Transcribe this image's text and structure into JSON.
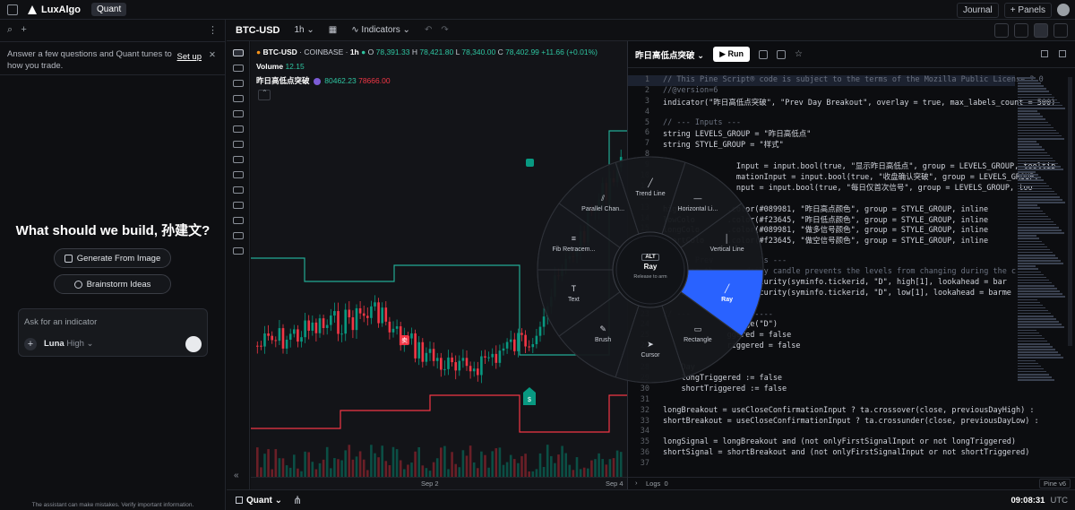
{
  "app": {
    "brand": "LuxAlgo",
    "mode": "Quant",
    "journal": "Journal",
    "panels": "Panels"
  },
  "left": {
    "notice_text": "Answer a few questions and Quant tunes to how you trade.",
    "setup_label": "Set up",
    "hero": "What should we build, 孙建文?",
    "generate_label": "Generate From Image",
    "brainstorm_label": "Brainstorm Ideas",
    "ask_placeholder": "Ask for an indicator",
    "model_name": "Luna",
    "model_level": "High",
    "disclaimer": "The assistant can make mistakes. Verify important information."
  },
  "chart_header": {
    "symbol": "BTC-USD",
    "interval": "1h",
    "indicators": "Indicators"
  },
  "legend": {
    "symbol": "BTC-USD",
    "exchange": "COINBASE",
    "interval": "1h",
    "o_label": "O",
    "o": "78,391.33",
    "h_label": "H",
    "h": "78,421.80",
    "l_label": "L",
    "l": "78,340.00",
    "c_label": "C",
    "c": "78,402.99",
    "change": "+11.66 (+0.01%)",
    "volume_label": "Volume",
    "volume": "12.15",
    "indicator_name": "昨日高低点突破",
    "ind_high": "80462.23",
    "ind_low": "78666.00"
  },
  "xaxis": {
    "labels": [
      "Sep 2",
      "Sep 4"
    ]
  },
  "bottom": {
    "quant": "Quant",
    "time": "09:08:31",
    "tz": "UTC"
  },
  "editor": {
    "script_name": "昨日高低点突破",
    "run_label": "Run",
    "logs_label": "Logs",
    "logs_count": "0",
    "pine_version": "Pine v6",
    "lines": [
      {
        "n": "1",
        "t": "// This Pine Script® code is subject to the terms of the Mozilla Public License 2.0"
      },
      {
        "n": "2",
        "t": "//@version=6"
      },
      {
        "n": "3",
        "t": "indicator(\"昨日高低点突破\", \"Prev Day Breakout\", overlay = true, max_labels_count = 500)"
      },
      {
        "n": "4",
        "t": ""
      },
      {
        "n": "5",
        "t": "// --- Inputs ---"
      },
      {
        "n": "6",
        "t": "string LEVELS_GROUP = \"昨日高低点\""
      },
      {
        "n": "7",
        "t": "string STYLE_GROUP = \"样式\""
      },
      {
        "n": "8",
        "t": ""
      },
      {
        "n": "9",
        "t": "                Input = input.bool(true, \"显示昨日高低点\", group = LEVELS_GROUP, tooltip"
      },
      {
        "n": "10",
        "t": "                mationInput = input.bool(true, \"收盘确认突破\", group = LEVELS_GROUP,"
      },
      {
        "n": "11",
        "t": "                nput = input.bool(true, \"每日仅首次信号\", group = LEVELS_GROUP, too"
      },
      {
        "n": "12",
        "t": ""
      },
      {
        "n": "13",
        "t": "highC         .color(#089981, \"昨日高点颜色\", group = STYLE_GROUP, inline"
      },
      {
        "n": "14",
        "t": "lowColo       .color(#f23645, \"昨日低点颜色\", group = STYLE_GROUP, inline"
      },
      {
        "n": "15",
        "t": "longColo      .color(#089981, \"做多信号颜色\", group = STYLE_GROUP, inline"
      },
      {
        "n": "16",
        "t": "shortColo     .color(#f23645, \"做空信号颜色\", group = STYLE_GROUP, inline"
      },
      {
        "n": "17",
        "t": ""
      },
      {
        "n": "18",
        "t": "// --- Prev          ls ---"
      },
      {
        "n": "19",
        "t": "// Using th       daily candle prevents the levels from changing during the c"
      },
      {
        "n": "20",
        "t": "previousDayH    st.security(syminfo.tickerid, \"D\", high[1], lookahead = bar"
      },
      {
        "n": "21",
        "t": "previousDay     st.security(syminfo.tickerid, \"D\", low[1], lookahead = barme"
      },
      {
        "n": "22",
        "t": ""
      },
      {
        "n": "23",
        "t": "// ---              ----"
      },
      {
        "n": "24",
        "t": "              change(\"D\")"
      },
      {
        "n": "25",
        "t": "              ggered = false"
      },
      {
        "n": "26",
        "t": "              riggered = false"
      },
      {
        "n": "27",
        "t": ""
      },
      {
        "n": "28",
        "t": "    Day"
      },
      {
        "n": "29",
        "t": "    longTriggered := false"
      },
      {
        "n": "30",
        "t": "    shortTriggered := false"
      },
      {
        "n": "31",
        "t": ""
      },
      {
        "n": "32",
        "t": "longBreakout = useCloseConfirmationInput ? ta.crossover(close, previousDayHigh) :"
      },
      {
        "n": "33",
        "t": "shortBreakout = useCloseConfirmationInput ? ta.crossunder(close, previousDayLow) :"
      },
      {
        "n": "34",
        "t": ""
      },
      {
        "n": "35",
        "t": "longSignal = longBreakout and (not onlyFirstSignalInput or not longTriggered)"
      },
      {
        "n": "36",
        "t": "shortSignal = shortBreakout and (not onlyFirstSignalInput or not shortTriggered)"
      },
      {
        "n": "37",
        "t": ""
      }
    ]
  },
  "radial": {
    "items": [
      "Trend Line",
      "Horizontal Li...",
      "Vertical Line",
      "Ray",
      "Rectangle",
      "Cursor",
      "Brush",
      "Text",
      "Fib Retracem...",
      "Parallel Chan..."
    ],
    "center_key": "ALT",
    "center_title": "Ray",
    "center_sub": "Release to arm"
  },
  "colors": {
    "up": "#089981",
    "down": "#f23645",
    "accent": "#2962ff",
    "teal_line": "#22ab94"
  }
}
